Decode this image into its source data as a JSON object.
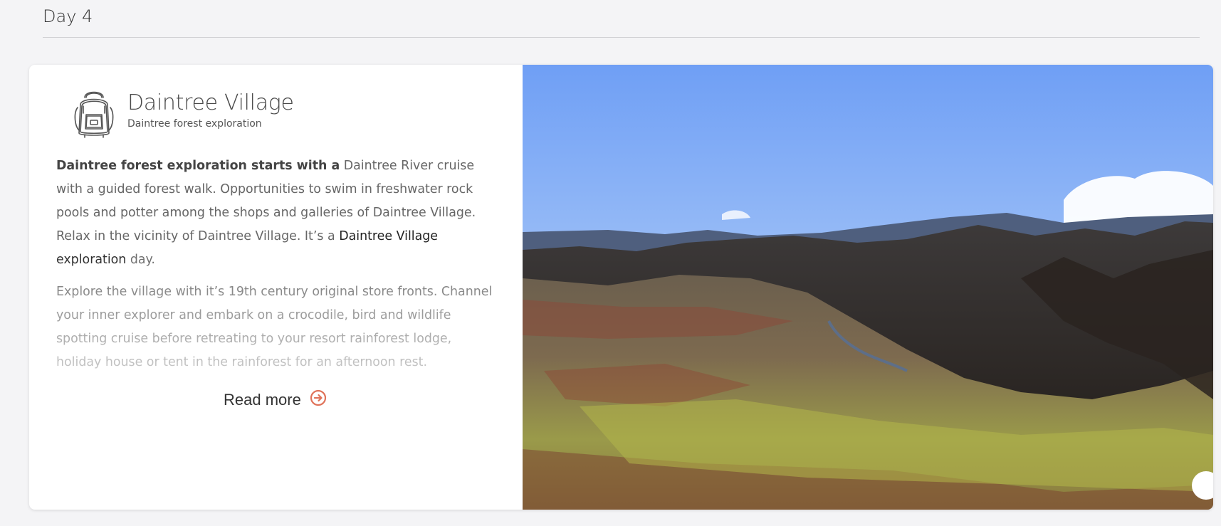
{
  "day": {
    "title": "Day 4"
  },
  "card": {
    "title": "Daintree Village",
    "subtitle": "Daintree forest exploration",
    "icon": "backpack-icon",
    "paragraph1": {
      "bold_lead": "Daintree forest exploration starts with a",
      "text_a": " Daintree River cruise with a guided forest walk.  Opportunities to swim in freshwater rock pools and potter among the shops and galleries of Daintree Village. Relax in the vicinity of Daintree Village. It’s a ",
      "highlight": " Daintree Village exploration",
      "text_b": " day."
    },
    "paragraph2": "Explore the village with it’s 19th century original store fronts. Channel your inner explorer and embark on a crocodile, bird and wildlife spotting cruise before retreating to your resort rainforest lodge, holiday house or  tent in the rainforest for an afternoon rest.",
    "read_more_label": "Read more",
    "read_more_icon": "arrow-circle-right-icon",
    "image_alt": "Daintree landscape photo"
  },
  "colors": {
    "accent": "#e0735a",
    "background": "#f4f4f6",
    "card": "#ffffff"
  }
}
